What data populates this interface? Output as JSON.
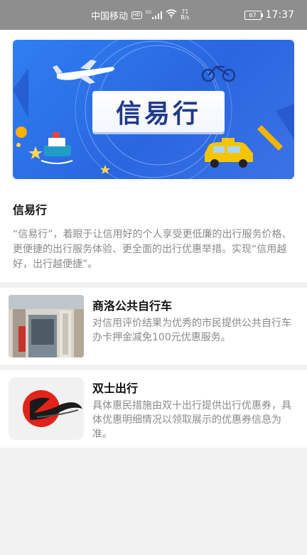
{
  "status_bar": {
    "carrier": "中国移动",
    "hd": "HD",
    "network": "5G",
    "speed_value": "71",
    "speed_unit": "B/s",
    "battery": "67",
    "time": "17:37"
  },
  "intro": {
    "banner_text": "信易行",
    "title": "信易行",
    "description": "“信易行”，着眼于让信用好的个人享受更低廉的出行服务价格、更便捷的出行服务体验、更全面的出行优惠举措。实现“信用越好，出行越便捷”。"
  },
  "services": [
    {
      "title": "商洛公共自行车",
      "description": "对信用评价结果为优秀的市民提供公共自行车办卡押金减免100元优惠服务。"
    },
    {
      "title": "双士出行",
      "description": "具体惠民措施由双十出行提供出行优惠券，具体优惠明细情况以领取展示的优惠券信息为准。"
    }
  ],
  "colors": {
    "status_bar": "#8e8e8e",
    "banner_blue": "#2f7ff0",
    "logo_red": "#e2231a",
    "muted_text": "#8a8a8a"
  }
}
